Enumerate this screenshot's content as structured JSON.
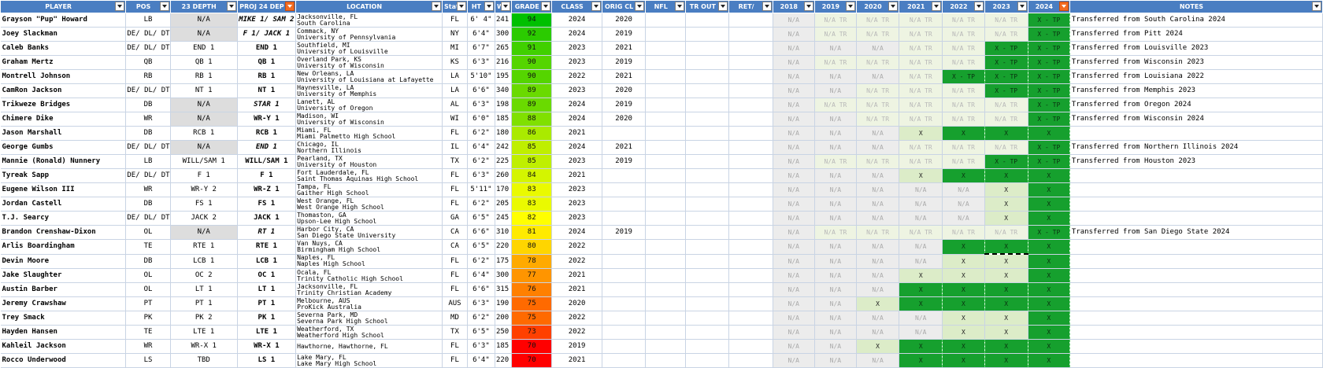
{
  "columns": [
    "PLAYER",
    "POS",
    "23 DEPTH",
    "PROJ 24 DEP",
    "LOCATION",
    "State",
    "HT",
    "W",
    "GRADE",
    "CLASS",
    "ORIG CL",
    "NFL",
    "TR OUT",
    "RET/",
    "2018",
    "2019",
    "2020",
    "2021",
    "2022",
    "2023",
    "2024",
    "NOTES"
  ],
  "active_filter_columns": [
    "PROJ 24 DEP",
    "2024"
  ],
  "colors": {
    "header": "#4a7ec2",
    "filter_active": "#f26b21",
    "x_green": "#16a02e",
    "x_light": "#dcecc8",
    "na_grey": "#ececec",
    "tr_light": "#eef4e2"
  },
  "rows": [
    {
      "player": "Grayson \"Pup\" Howard",
      "pos": "LB",
      "depth23": "N/A",
      "proj24": "MIKE 1/ SAM 2",
      "loc1": "Jacksonville, FL",
      "loc2": "South Carolina",
      "state": "FL",
      "ht": "6' 4\"",
      "w": "241",
      "grade": "94",
      "class": "2024",
      "orig": "2020",
      "years": [
        "N/A",
        "N/A TR",
        "N/A TR",
        "N/A TR",
        "N/A TR",
        "N/A TR",
        "X - TP"
      ],
      "notes": "Transferred from South Carolina 2024"
    },
    {
      "player": "Joey Slackman",
      "pos": "DE/ DL/ DT",
      "depth23": "N/A",
      "proj24": "F 1/ JACK 1",
      "loc1": "Commack, NY",
      "loc2": "University of Pennsylvania",
      "state": "NY",
      "ht": "6'4\"",
      "w": "300",
      "grade": "92",
      "class": "2024",
      "orig": "2019",
      "years": [
        "N/A",
        "N/A TR",
        "N/A TR",
        "N/A TR",
        "N/A TR",
        "N/A TR",
        "X - TP"
      ],
      "notes": "Transferred from Pitt 2024"
    },
    {
      "player": "Caleb Banks",
      "pos": "DE/ DL/ DT",
      "depth23": "END 1",
      "proj24": "END 1",
      "loc1": "Southfield, MI",
      "loc2": "University of Louisville",
      "state": "MI",
      "ht": "6'7\"",
      "w": "265",
      "grade": "91",
      "class": "2023",
      "orig": "2021",
      "years": [
        "N/A",
        "N/A",
        "N/A",
        "N/A TR",
        "N/A TR",
        "X - TP",
        "X - TP"
      ],
      "notes": "Transferred from Louisville 2023"
    },
    {
      "player": "Graham Mertz",
      "pos": "QB",
      "depth23": "QB 1",
      "proj24": "QB 1",
      "loc1": "Overland Park, KS",
      "loc2": "University of Wisconsin",
      "state": "KS",
      "ht": "6'3\"",
      "w": "216",
      "grade": "90",
      "class": "2023",
      "orig": "2019",
      "years": [
        "N/A",
        "N/A TR",
        "N/A TR",
        "N/A TR",
        "N/A TR",
        "X - TP",
        "X - TP"
      ],
      "notes": "Transferred from Wisconsin 2023"
    },
    {
      "player": "Montrell Johnson",
      "pos": "RB",
      "depth23": "RB 1",
      "proj24": "RB 1",
      "loc1": "New Orleans, LA",
      "loc2": "University of Louisiana at Lafayette",
      "state": "LA",
      "ht": "5'10\"",
      "w": "195",
      "grade": "90",
      "class": "2022",
      "orig": "2021",
      "years": [
        "N/A",
        "N/A",
        "N/A",
        "N/A TR",
        "X - TP",
        "X - TP",
        "X - TP"
      ],
      "notes": "Transferred from Louisiana 2022"
    },
    {
      "player": "CamRon Jackson",
      "pos": "DE/ DL/ DT",
      "depth23": "NT 1",
      "proj24": "NT 1",
      "loc1": "Haynesville, LA",
      "loc2": "University of Memphis",
      "state": "LA",
      "ht": "6'6\"",
      "w": "340",
      "grade": "89",
      "class": "2023",
      "orig": "2020",
      "years": [
        "N/A",
        "N/A",
        "N/A TR",
        "N/A TR",
        "N/A TR",
        "X - TP",
        "X - TP"
      ],
      "notes": "Transferred from Memphis 2023"
    },
    {
      "player": "Trikweze Bridges",
      "pos": "DB",
      "depth23": "N/A",
      "proj24": "STAR 1",
      "loc1": "Lanett, AL",
      "loc2": "University of Oregon",
      "state": "AL",
      "ht": "6'3\"",
      "w": "198",
      "grade": "89",
      "class": "2024",
      "orig": "2019",
      "years": [
        "N/A",
        "N/A TR",
        "N/A TR",
        "N/A TR",
        "N/A TR",
        "N/A TR",
        "X - TP"
      ],
      "notes": "Transferred from Oregon 2024"
    },
    {
      "player": "Chimere Dike",
      "pos": "WR",
      "depth23": "N/A",
      "proj24": "WR-Y 1",
      "loc1": "Madison, WI",
      "loc2": "University of Wisconsin",
      "state": "WI",
      "ht": "6'0\"",
      "w": "185",
      "grade": "88",
      "class": "2024",
      "orig": "2020",
      "years": [
        "N/A",
        "N/A",
        "N/A TR",
        "N/A TR",
        "N/A TR",
        "N/A TR",
        "X - TP"
      ],
      "notes": "Transferred from Wisconsin 2024"
    },
    {
      "player": "Jason Marshall",
      "pos": "DB",
      "depth23": "RCB 1",
      "proj24": "RCB 1",
      "loc1": "Miami, FL",
      "loc2": "Miami Palmetto High School",
      "state": "FL",
      "ht": "6'2\"",
      "w": "180",
      "grade": "86",
      "class": "2021",
      "orig": "",
      "years": [
        "N/A",
        "N/A",
        "N/A",
        "X",
        "X",
        "X",
        "X"
      ],
      "notes": ""
    },
    {
      "player": "George Gumbs",
      "pos": "DE/ DL/ DT",
      "depth23": "N/A",
      "proj24": "END 1",
      "loc1": "Chicago, IL",
      "loc2": "Northern Illinois",
      "state": "IL",
      "ht": "6'4\"",
      "w": "242",
      "grade": "85",
      "class": "2024",
      "orig": "2021",
      "years": [
        "N/A",
        "N/A",
        "N/A",
        "N/A TR",
        "N/A TR",
        "N/A TR",
        "X - TP"
      ],
      "notes": "Transferred from Northern Illinois 2024"
    },
    {
      "player": "Mannie (Ronald) Nunnery",
      "pos": "LB",
      "depth23": "WILL/SAM 1",
      "proj24": "WILL/SAM 1",
      "loc1": "Pearland, TX",
      "loc2": "University of Houston",
      "state": "TX",
      "ht": "6'2\"",
      "w": "225",
      "grade": "85",
      "class": "2023",
      "orig": "2019",
      "years": [
        "N/A",
        "N/A TR",
        "N/A TR",
        "N/A TR",
        "N/A TR",
        "X - TP",
        "X - TP"
      ],
      "notes": "Transferred from Houston 2023"
    },
    {
      "player": "Tyreak Sapp",
      "pos": "DE/ DL/ DT",
      "depth23": "F 1",
      "proj24": "F 1",
      "loc1": "Fort Lauderdale, FL",
      "loc2": "Saint Thomas Aquinas High School",
      "state": "FL",
      "ht": "6'3\"",
      "w": "260",
      "grade": "84",
      "class": "2021",
      "orig": "",
      "years": [
        "N/A",
        "N/A",
        "N/A",
        "X",
        "X",
        "X",
        "X"
      ],
      "notes": ""
    },
    {
      "player": "Eugene Wilson III",
      "pos": "WR",
      "depth23": "WR-Y 2",
      "proj24": "WR-Z 1",
      "loc1": "Tampa, FL",
      "loc2": "Gaither High School",
      "state": "FL",
      "ht": "5'11\"",
      "w": "170",
      "grade": "83",
      "class": "2023",
      "orig": "",
      "years": [
        "N/A",
        "N/A",
        "N/A",
        "N/A",
        "N/A",
        "X",
        "X"
      ],
      "notes": ""
    },
    {
      "player": "Jordan Castell",
      "pos": "DB",
      "depth23": "FS 1",
      "proj24": "FS 1",
      "loc1": "West Orange, FL",
      "loc2": "West Orange High School",
      "state": "FL",
      "ht": "6'2\"",
      "w": "205",
      "grade": "83",
      "class": "2023",
      "orig": "",
      "years": [
        "N/A",
        "N/A",
        "N/A",
        "N/A",
        "N/A",
        "X",
        "X"
      ],
      "notes": ""
    },
    {
      "player": "T.J. Searcy",
      "pos": "DE/ DL/ DT",
      "depth23": "JACK 2",
      "proj24": "JACK 1",
      "loc1": "Thomaston, GA",
      "loc2": "Upson-Lee High School",
      "state": "GA",
      "ht": "6'5\"",
      "w": "245",
      "grade": "82",
      "class": "2023",
      "orig": "",
      "years": [
        "N/A",
        "N/A",
        "N/A",
        "N/A",
        "N/A",
        "X",
        "X"
      ],
      "notes": ""
    },
    {
      "player": "Brandon Crenshaw-Dixon",
      "pos": "OL",
      "depth23": "N/A",
      "proj24": "RT 1",
      "loc1": "Harbor City, CA",
      "loc2": "San Diego State University",
      "state": "CA",
      "ht": "6'6\"",
      "w": "310",
      "grade": "81",
      "class": "2024",
      "orig": "2019",
      "years": [
        "N/A",
        "N/A TR",
        "N/A TR",
        "N/A TR",
        "N/A TR",
        "N/A TR",
        "X - TP"
      ],
      "notes": "Transferred from San Diego State 2024"
    },
    {
      "player": "Arlis Boardingham",
      "pos": "TE",
      "depth23": "RTE 1",
      "proj24": "RTE 1",
      "loc1": "Van Nuys, CA",
      "loc2": "Birmingham High School",
      "state": "CA",
      "ht": "6'5\"",
      "w": "220",
      "grade": "80",
      "class": "2022",
      "orig": "",
      "years": [
        "N/A",
        "N/A",
        "N/A",
        "N/A",
        "X",
        "X",
        "X"
      ],
      "notes": ""
    },
    {
      "player": "Devin Moore",
      "pos": "DB",
      "depth23": "LCB 1",
      "proj24": "LCB 1",
      "loc1": "Naples, FL",
      "loc2": "Naples High School",
      "state": "FL",
      "ht": "6'2\"",
      "w": "175",
      "grade": "78",
      "class": "2022",
      "orig": "",
      "years": [
        "N/A",
        "N/A",
        "N/A",
        "N/A",
        "X",
        "X",
        "X"
      ],
      "notes": ""
    },
    {
      "player": "Jake Slaughter",
      "pos": "OL",
      "depth23": "OC 2",
      "proj24": "OC 1",
      "loc1": "Ocala, FL",
      "loc2": "Trinity Catholic High School",
      "state": "FL",
      "ht": "6'4\"",
      "w": "300",
      "grade": "77",
      "class": "2021",
      "orig": "",
      "years": [
        "N/A",
        "N/A",
        "N/A",
        "X",
        "X",
        "X",
        "X"
      ],
      "notes": ""
    },
    {
      "player": "Austin Barber",
      "pos": "OL",
      "depth23": "LT 1",
      "proj24": "LT 1",
      "loc1": "Jacksonville, FL",
      "loc2": "Trinity Christian Academy",
      "state": "FL",
      "ht": "6'6\"",
      "w": "315",
      "grade": "76",
      "class": "2021",
      "orig": "",
      "years": [
        "N/A",
        "N/A",
        "N/A",
        "X",
        "X",
        "X",
        "X"
      ],
      "notes": ""
    },
    {
      "player": "Jeremy Crawshaw",
      "pos": "PT",
      "depth23": "PT 1",
      "proj24": "PT 1",
      "loc1": "Melbourne, AUS",
      "loc2": "ProKick Australia",
      "state": "AUS",
      "ht": "6'3\"",
      "w": "190",
      "grade": "75",
      "class": "2020",
      "orig": "",
      "years": [
        "N/A",
        "N/A",
        "X",
        "X",
        "X",
        "X",
        "X"
      ],
      "notes": ""
    },
    {
      "player": "Trey Smack",
      "pos": "PK",
      "depth23": "PK 2",
      "proj24": "PK 1",
      "loc1": "Severna Park, MD",
      "loc2": "Severna Park High School",
      "state": "MD",
      "ht": "6'2\"",
      "w": "200",
      "grade": "75",
      "class": "2022",
      "orig": "",
      "years": [
        "N/A",
        "N/A",
        "N/A",
        "N/A",
        "X",
        "X",
        "X"
      ],
      "notes": ""
    },
    {
      "player": "Hayden Hansen",
      "pos": "TE",
      "depth23": "LTE 1",
      "proj24": "LTE 1",
      "loc1": "Weatherford, TX",
      "loc2": "Weatherford High School",
      "state": "TX",
      "ht": "6'5\"",
      "w": "250",
      "grade": "73",
      "class": "2022",
      "orig": "",
      "years": [
        "N/A",
        "N/A",
        "N/A",
        "N/A",
        "X",
        "X",
        "X"
      ],
      "notes": ""
    },
    {
      "player": "Kahleil Jackson",
      "pos": "WR",
      "depth23": "WR-X 1",
      "proj24": "WR-X 1",
      "loc1": "",
      "loc2": "Hawthorne, Hawthorne, FL",
      "state": "FL",
      "ht": "6'3\"",
      "w": "185",
      "grade": "70",
      "class": "2019",
      "orig": "",
      "years": [
        "N/A",
        "N/A",
        "X",
        "X",
        "X",
        "X",
        "X"
      ],
      "notes": ""
    },
    {
      "player": "Rocco Underwood",
      "pos": "LS",
      "depth23": "TBD",
      "proj24": "LS 1",
      "loc1": "Lake Mary, FL",
      "loc2": "Lake Mary High School",
      "state": "FL",
      "ht": "6'4\"",
      "w": "220",
      "grade": "70",
      "class": "2021",
      "orig": "",
      "years": [
        "N/A",
        "N/A",
        "N/A",
        "X",
        "X",
        "X",
        "X"
      ],
      "notes": ""
    }
  ]
}
